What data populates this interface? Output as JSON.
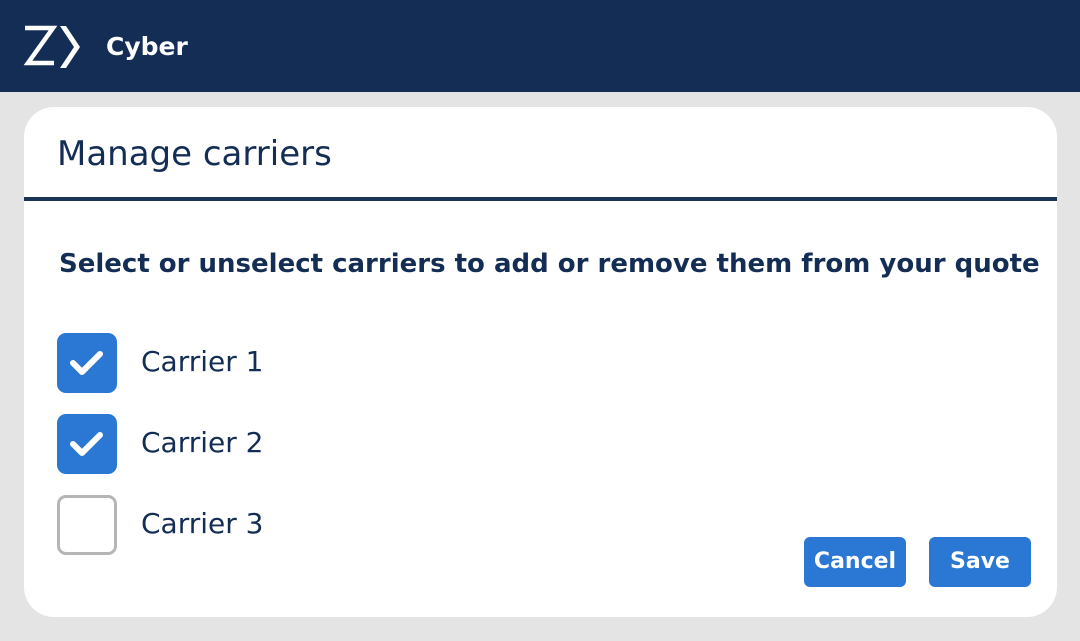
{
  "header": {
    "title": "Cyber",
    "logo_icon": "z-chevron-logo-icon",
    "background_color": "#142d55"
  },
  "dialog": {
    "title": "Manage carriers",
    "instruction": "Select or unselect carriers to add or remove them from your quote",
    "carriers": [
      {
        "label": "Carrier 1",
        "checked": true
      },
      {
        "label": "Carrier 2",
        "checked": true
      },
      {
        "label": "Carrier 3",
        "checked": false
      }
    ],
    "cancel_label": "Cancel",
    "save_label": "Save",
    "accent_color": "#2a77d4",
    "text_color": "#142d55"
  }
}
